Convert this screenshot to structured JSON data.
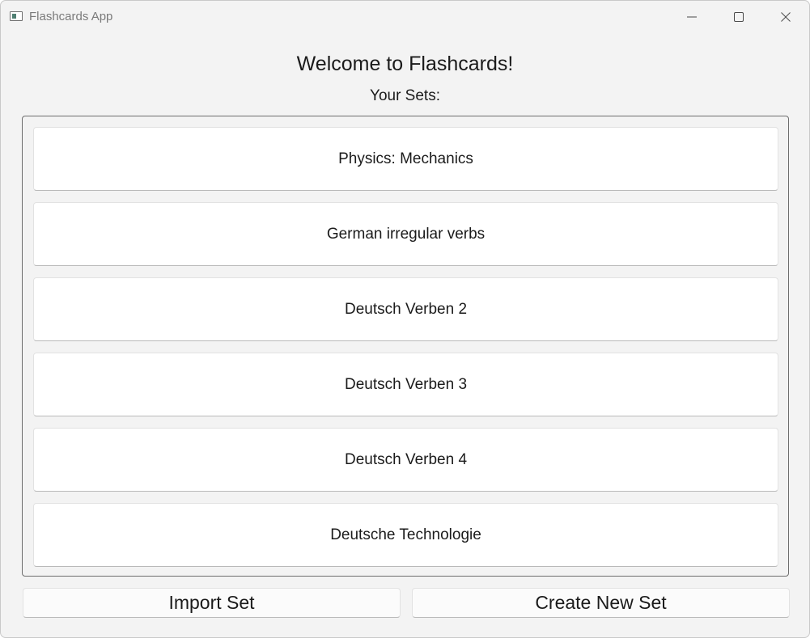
{
  "window": {
    "title": "Flashcards App",
    "icon": "app-window-icon",
    "controls": {
      "minimize_icon": "minimize-icon",
      "maximize_icon": "maximize-icon",
      "close_icon": "close-icon"
    }
  },
  "main": {
    "heading": "Welcome to Flashcards!",
    "subheading": "Your Sets:",
    "sets": [
      {
        "label": "Physics: Mechanics"
      },
      {
        "label": "German irregular verbs"
      },
      {
        "label": "Deutsch Verben 2"
      },
      {
        "label": "Deutsch Verben 3"
      },
      {
        "label": "Deutsch Verben 4"
      },
      {
        "label": "Deutsche Technologie"
      }
    ]
  },
  "footer": {
    "import_label": "Import Set",
    "create_label": "Create New Set"
  },
  "colors": {
    "window_background": "#f3f3f3",
    "button_background": "#ffffff",
    "frame_border": "#6d6d6d",
    "text": "#1b1b1b",
    "title_text": "#7a7a7a"
  }
}
